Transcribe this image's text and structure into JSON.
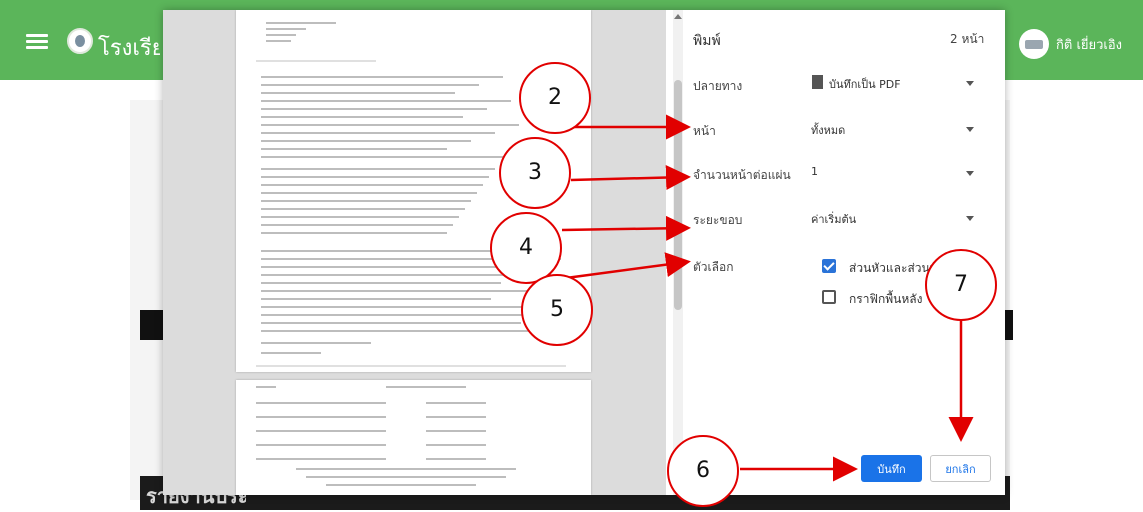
{
  "app_bar": {
    "title": "โรงเรียน",
    "user_name": "กิติ เยี่ยวเอิง",
    "menu_icon": "hamburger-icon",
    "logo_icon": "school-logo-icon",
    "avatar_icon": "avatar-icon",
    "color": "#5bb55a"
  },
  "background_page": {
    "bottom_heading": "รายงานประเมินครู"
  },
  "print_dialog": {
    "title": "พิมพ์",
    "page_count": "2 หน้า",
    "destination": {
      "label": "ปลายทาง",
      "value": "บันทึกเป็น PDF",
      "icon": "pdf-file-icon"
    },
    "pages": {
      "label": "หน้า",
      "value": "ทั้งหมด"
    },
    "pages_per_sheet": {
      "label": "จำนวนหน้าต่อแผ่น",
      "value": "1"
    },
    "margins": {
      "label": "ระยะขอบ",
      "value": "ค่าเริ่มต้น"
    },
    "options": {
      "label": "ตัวเลือก",
      "items": [
        {
          "label": "ส่วนหัวและส่วนท้าย",
          "checked": true
        },
        {
          "label": "กราฟิกพื้นหลัง",
          "checked": false
        }
      ]
    },
    "save_button": "บันทึก",
    "cancel_button": "ยกเลิก",
    "accent_color": "#1a73e8"
  },
  "annotations": {
    "color": "#e10000",
    "markers": [
      "2",
      "3",
      "4",
      "5",
      "6",
      "7"
    ]
  }
}
